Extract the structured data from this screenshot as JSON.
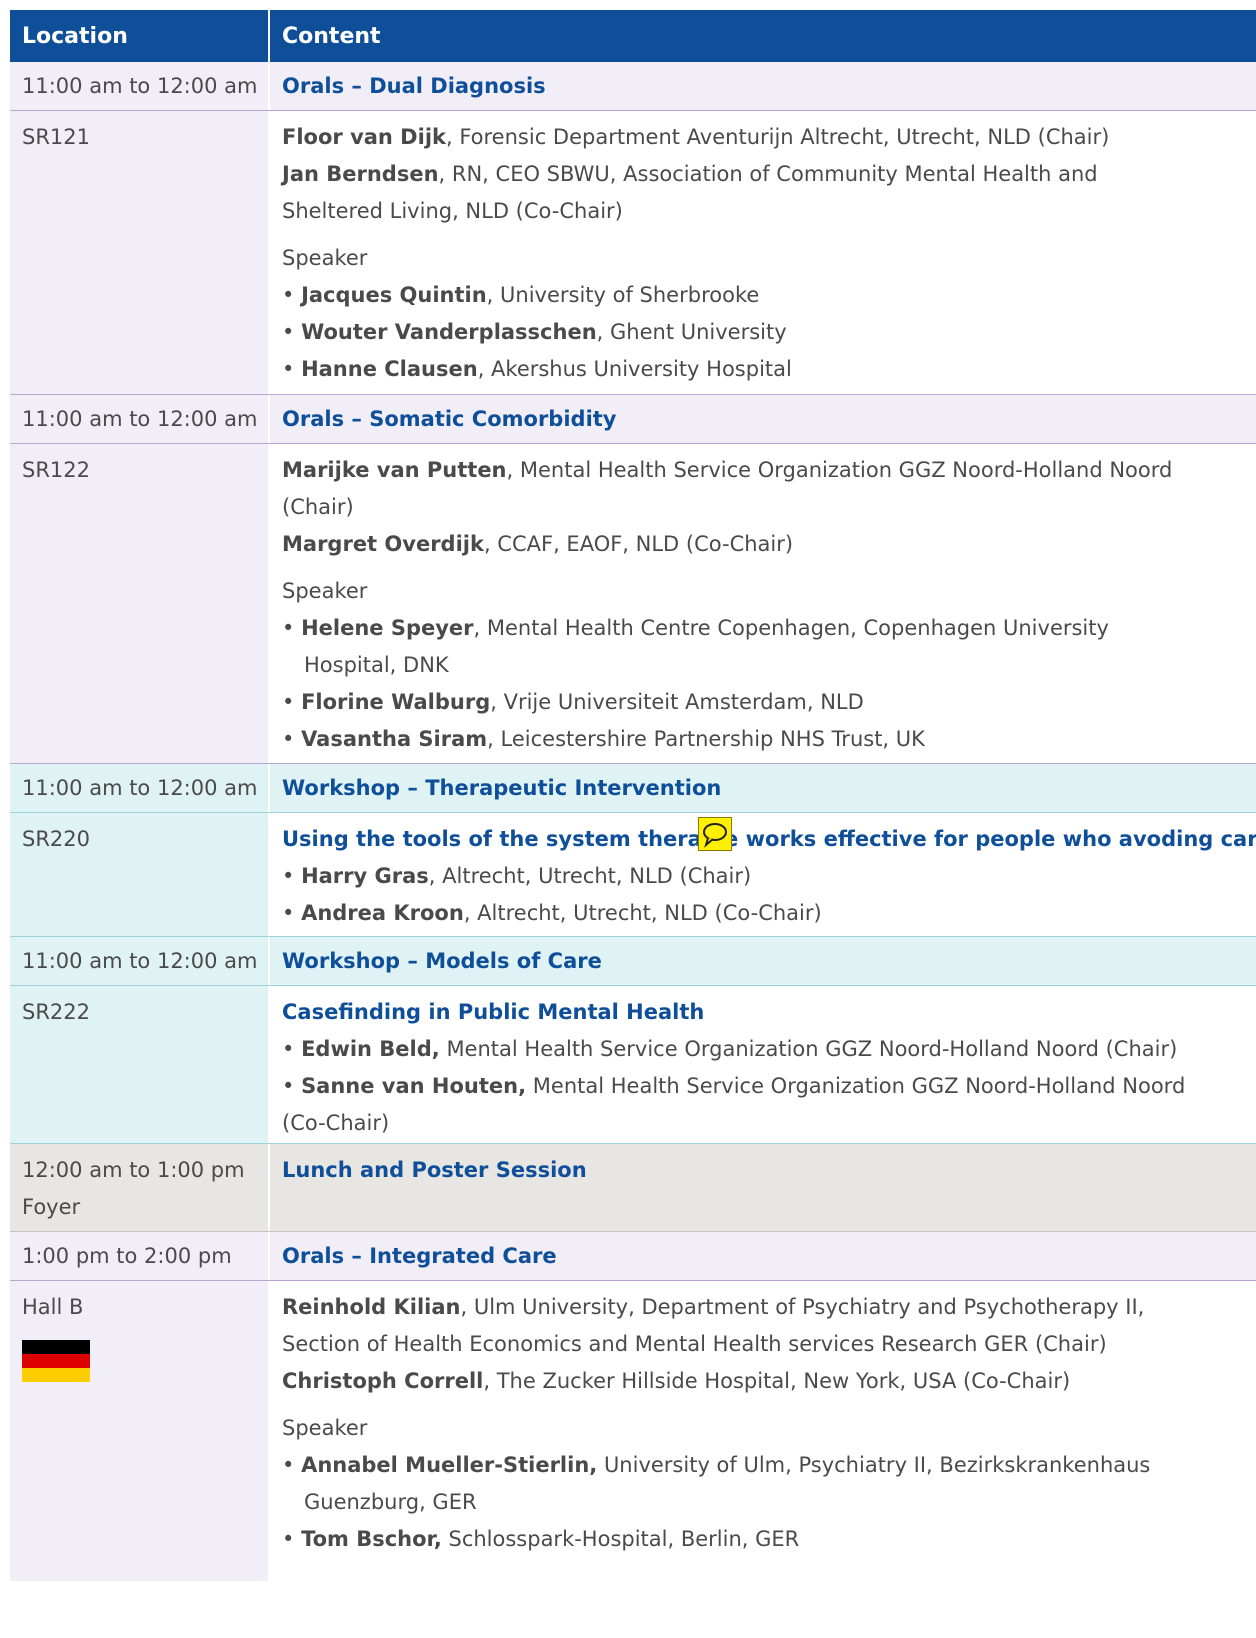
{
  "header": {
    "location": "Location",
    "content": "Content"
  },
  "sessions": [
    {
      "time": "11:00 am to 12:00 am",
      "title": "Orals – Dual Diagnosis",
      "room": "SR121",
      "chairs": [
        {
          "name": "Floor van Dijk",
          "text": ", Forensic Department Aventurijn Altrecht, Utrecht, NLD (Chair)"
        },
        {
          "name": "Jan Berndsen",
          "text": ", RN, CEO SBWU, Association of Community Mental Health and"
        },
        {
          "name": "",
          "text": "Sheltered Living, NLD (Co-Chair)"
        }
      ],
      "speaker_label": "Speaker",
      "speakers": [
        {
          "name": "Jacques Quintin",
          "text": ", University of Sherbrooke"
        },
        {
          "name": "Wouter Vanderplasschen",
          "text": ", Ghent University"
        },
        {
          "name": "Hanne Clausen",
          "text": ", Akershus University Hospital"
        }
      ]
    },
    {
      "time": "11:00 am to 12:00 am",
      "title": "Orals – Somatic Comorbidity",
      "room": "SR122",
      "chairs": [
        {
          "name": "Marijke van Putten",
          "text": ", Mental Health Service Organization GGZ Noord-Holland Noord"
        },
        {
          "name": "",
          "text": "(Chair)"
        },
        {
          "name": "Margret Overdijk",
          "text": ", CCAF, EAOF, NLD (Co-Chair)"
        }
      ],
      "speaker_label": "Speaker",
      "speakers": [
        {
          "name": "Helene Speyer",
          "text": ", Mental Health Centre Copenhagen, Copenhagen University"
        },
        {
          "name": "",
          "text": "Hospital, DNK",
          "cont": true
        },
        {
          "name": "Florine Walburg",
          "text": ", Vrije Universiteit Amsterdam, NLD"
        },
        {
          "name": "Vasantha Siram",
          "text": ", Leicestershire Partnership NHS Trust, UK"
        }
      ]
    },
    {
      "time": "11:00 am to 12:00 am",
      "title": "Workshop – Therapeutic Intervention",
      "room": "SR220",
      "subtitle": "Using the tools of the system therapie works effective for people who avoding care",
      "items": [
        {
          "name": "Harry Gras",
          "text": ", Altrecht, Utrecht, NLD (Chair)"
        },
        {
          "name": "Andrea Kroon",
          "text": ", Altrecht, Utrecht, NLD (Co-Chair)"
        }
      ]
    },
    {
      "time": "11:00 am to 12:00 am",
      "title": "Workshop – Models of Care",
      "room": "SR222",
      "subtitle": "Casefinding in Public Mental Health",
      "items": [
        {
          "name": "Edwin Beld,",
          "text": " Mental Health Service Organization GGZ Noord-Holland Noord (Chair)"
        },
        {
          "name": "Sanne van Houten,",
          "text": " Mental Health Service Organization GGZ Noord-Holland Noord"
        },
        {
          "name": "",
          "text": "(Co-Chair)",
          "cont": true
        }
      ]
    },
    {
      "time": "12:00 am to 1:00 pm",
      "room": "Foyer",
      "title": "Lunch and Poster Session"
    },
    {
      "time": "1:00 pm to 2:00 pm",
      "title": "Orals – Integrated Care",
      "room": "Hall B",
      "chairs": [
        {
          "name": "Reinhold Kilian",
          "text": ", Ulm University, Department of Psychiatry and Psychotherapy II,"
        },
        {
          "name": "",
          "text": "Section of Health Economics and Mental Health services Research GER (Chair)"
        },
        {
          "name": "Christoph Correll",
          "text": ", The Zucker Hillside Hospital, New York, USA (Co-Chair)"
        }
      ],
      "speaker_label": "Speaker",
      "speakers": [
        {
          "name": "Annabel Mueller-Stierlin,",
          "text": " University of Ulm, Psychiatry II, Bezirkskrankenhaus"
        },
        {
          "name": "",
          "text": "Guenzburg, GER",
          "cont": true
        },
        {
          "name": "Tom Bschor,",
          "text": " Schlosspark-Hospital, Berlin, GER"
        }
      ],
      "flag_colors": [
        "#000000",
        "#dd0000",
        "#ffce00"
      ]
    }
  ],
  "colors": {
    "header": "#0f4f9a",
    "accent": "#0f4f9a",
    "violet": "#f1eef7",
    "cyan": "#dff2f4",
    "grey": "#e8e6e3"
  },
  "annotation_icon": "speech-bubble-icon"
}
